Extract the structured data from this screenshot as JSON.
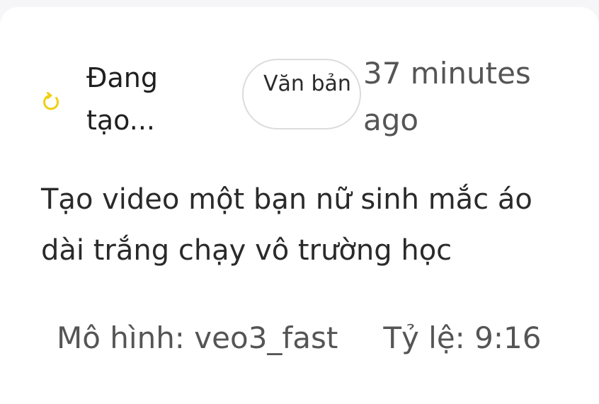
{
  "task": {
    "status_icon": "loading-spinner-icon",
    "status_color": "#f0cf10",
    "status_label": "Đang tạo...",
    "type_badge": "Văn bản",
    "time_ago": "37 minutes ago",
    "prompt": "Tạo video một bạn nữ sinh mắc áo dài trắng chạy vô trường học",
    "model_text": "Mô hình: veo3_fast",
    "ratio_text": "Tỷ lệ: 9:16"
  }
}
